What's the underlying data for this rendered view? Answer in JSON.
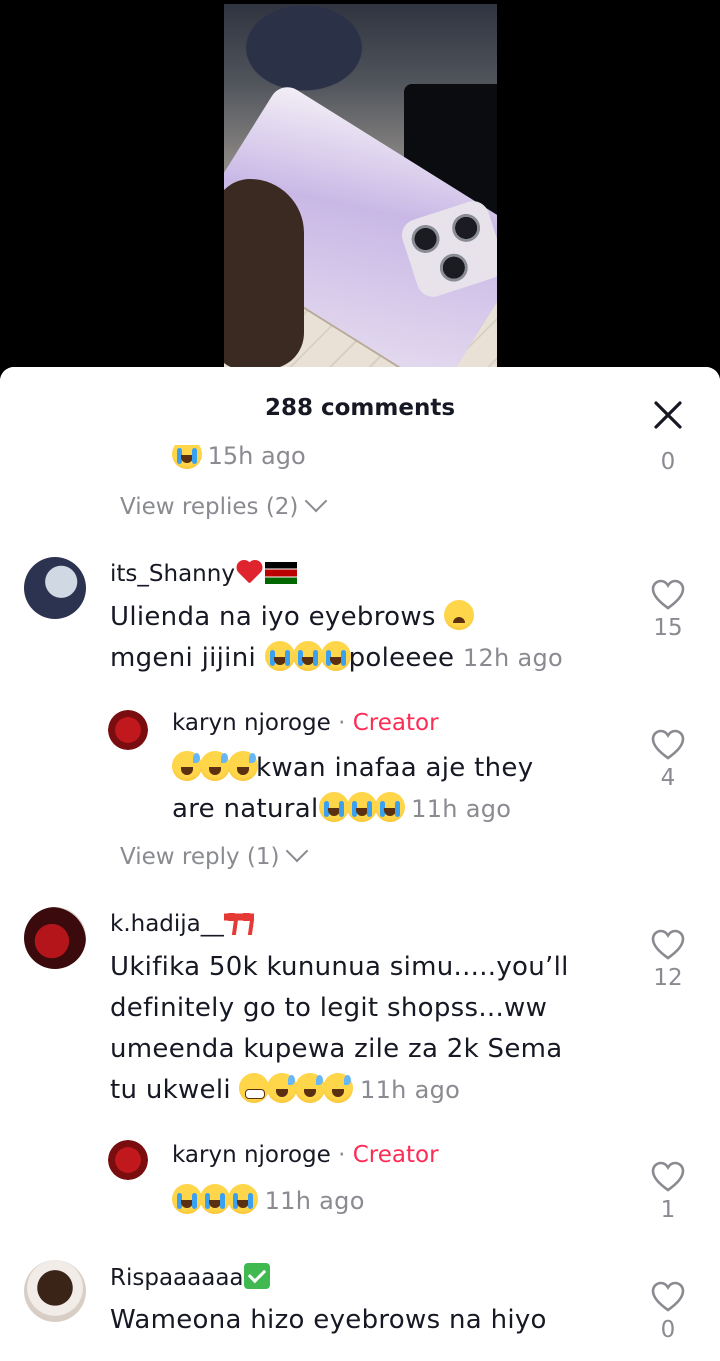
{
  "sheet": {
    "title": "288 comments"
  },
  "top_partial": {
    "timestamp": "15h ago",
    "like_count": "0",
    "view_replies": "View replies (2)"
  },
  "comments": [
    {
      "username": "its_Shanny",
      "text1": "Ulienda na iyo eyebrows",
      "text2_pre": "mgeni jijini",
      "text2_post": "poleeee",
      "timestamp": "12h ago",
      "like_count": "15",
      "reply": {
        "username": "karyn njoroge",
        "sep": " · ",
        "badge": "Creator",
        "text1": "kwan inafaa aje they",
        "text2": "are natural",
        "timestamp": "11h ago",
        "like_count": "4"
      },
      "view_reply": "View reply (1)"
    },
    {
      "username": "k.hadija__",
      "lines": [
        "Ukifika 50k kununua simu.....you’ll",
        "definitely go to legit shopss...ww",
        "umeenda kupewa zile za 2k Sema",
        "tu ukweli"
      ],
      "timestamp": "11h ago",
      "like_count": "12",
      "reply": {
        "username": "karyn njoroge",
        "sep": " · ",
        "badge": "Creator",
        "timestamp": "11h ago",
        "like_count": "1"
      }
    },
    {
      "username": "Rispaaaaaa",
      "text1": "Wameona hizo eyebrows na hiyo",
      "like_count": "0"
    }
  ],
  "icons": {
    "close": "close-icon",
    "like": "heart-outline-icon"
  },
  "colors": {
    "creator": "#fe2c55",
    "muted": "#8a8b91",
    "text": "#161823"
  }
}
